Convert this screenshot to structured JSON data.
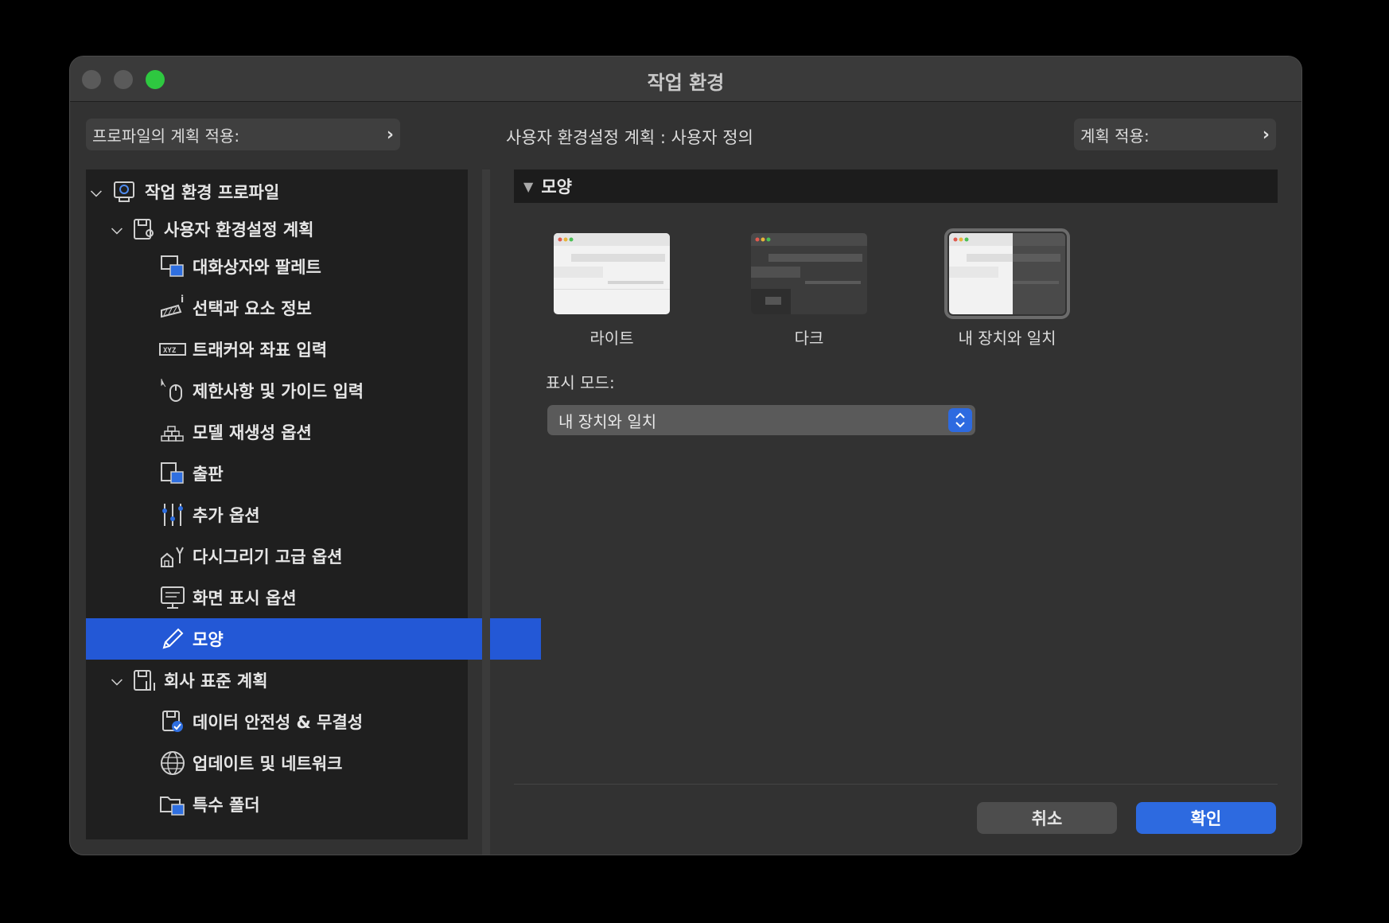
{
  "window": {
    "title": "작업 환경"
  },
  "header": {
    "profile_apply_label": "프로파일의 계획 적용:",
    "scheme_label": "사용자 환경설정 계획 : 사용자 정의",
    "scheme_apply_label": "계획 적용:"
  },
  "sidebar": {
    "root": {
      "label": "작업 환경 프로파일",
      "icon": "profile-icon"
    },
    "user_scheme": {
      "label": "사용자 환경설정 계획",
      "icon": "user-scheme-icon"
    },
    "user_items": [
      {
        "label": "대화상자와 팔레트",
        "icon": "dialogs-palettes-icon"
      },
      {
        "label": "선택과 요소 정보",
        "icon": "selection-info-icon"
      },
      {
        "label": "트래커와 좌표 입력",
        "icon": "xyz-tracker-icon"
      },
      {
        "label": "제한사항 및 가이드 입력",
        "icon": "mouse-constraints-icon"
      },
      {
        "label": "모델 재생성 옵션",
        "icon": "model-rebuild-icon"
      },
      {
        "label": "출판",
        "icon": "publishing-icon"
      },
      {
        "label": "추가 옵션",
        "icon": "sliders-icon"
      },
      {
        "label": "다시그리기 고급 옵션",
        "icon": "redraw-icon"
      },
      {
        "label": "화면 표시 옵션",
        "icon": "display-icon"
      },
      {
        "label": "모양",
        "icon": "pencil-icon",
        "selected": true
      }
    ],
    "company_scheme": {
      "label": "회사 표준 계획",
      "icon": "company-scheme-icon"
    },
    "company_items": [
      {
        "label": "데이터 안전성 & 무결성",
        "icon": "data-safety-icon"
      },
      {
        "label": "업데이트 및 네트워크",
        "icon": "globe-icon"
      },
      {
        "label": "특수 폴더",
        "icon": "special-folder-icon"
      }
    ]
  },
  "main": {
    "section_title": "모양",
    "themes": [
      {
        "label": "라이트",
        "selected": false
      },
      {
        "label": "다크",
        "selected": false
      },
      {
        "label": "내 장치와 일치",
        "selected": true
      }
    ],
    "display_mode_label": "표시 모드:",
    "display_mode_value": "내 장치와 일치"
  },
  "footer": {
    "cancel_label": "취소",
    "ok_label": "확인"
  },
  "colors": {
    "accent": "#2d6ae0",
    "selected_row": "#2358d6",
    "traffic_light_zoom": "#2ec840"
  }
}
